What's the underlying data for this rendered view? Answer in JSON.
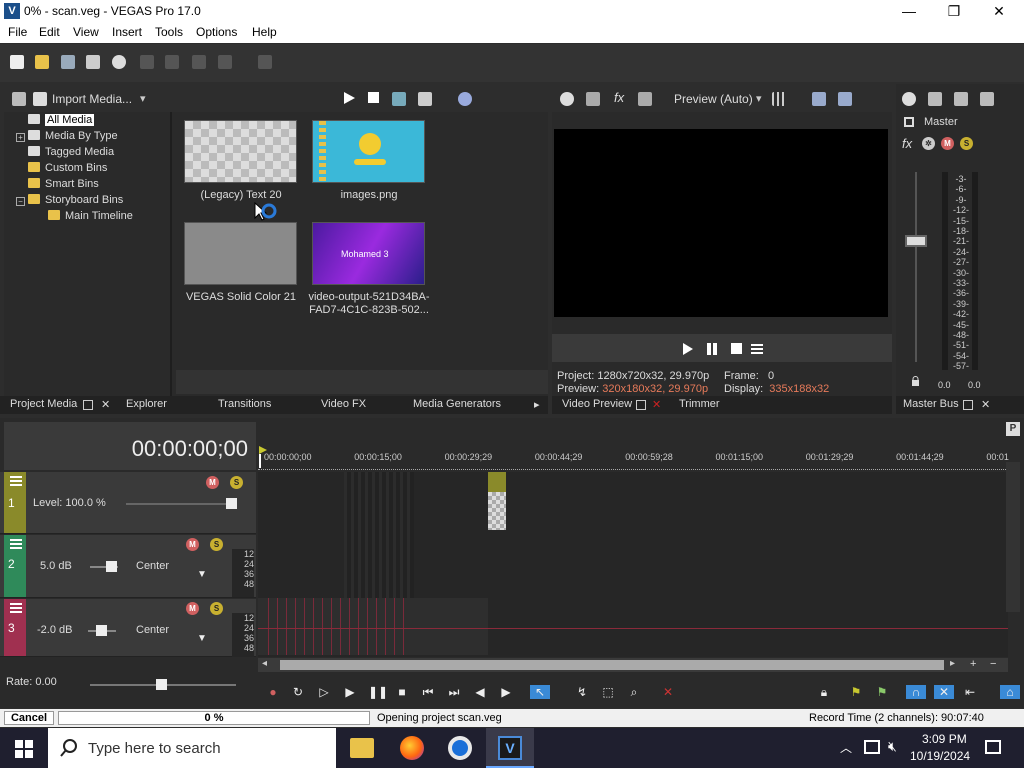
{
  "window": {
    "title": "0% - scan.veg - VEGAS Pro 17.0",
    "logo": "V",
    "minimize": "—",
    "maximize": "❐",
    "close": "✕"
  },
  "menu": [
    "File",
    "Edit",
    "View",
    "Insert",
    "Tools",
    "Options",
    "Help"
  ],
  "media_toolbar": {
    "import_label": "Import Media..."
  },
  "tree": {
    "all_media": "All Media",
    "by_type": "Media By Type",
    "tagged": "Tagged Media",
    "custom": "Custom Bins",
    "smart": "Smart Bins",
    "storyboard": "Storyboard Bins",
    "main_timeline": "Main Timeline",
    "expand": "+",
    "collapse": "−"
  },
  "media_items": [
    {
      "caption": "(Legacy) Text 20"
    },
    {
      "caption": "images.png"
    },
    {
      "caption": "VEGAS Solid Color 21"
    },
    {
      "caption": "video-output-521D34BA-FAD7-4C1C-823B-502...",
      "thumb_text": "Mohamed 3"
    }
  ],
  "left_tabs": {
    "project_media": "Project Media",
    "explorer": "Explorer",
    "transitions": "Transitions",
    "video_fx": "Video FX",
    "media_generators": "Media Generators"
  },
  "preview": {
    "quality": "Preview (Auto)",
    "project_label": "Project:",
    "project_value": "1280x720x32, 29.970p",
    "frame_label": "Frame:",
    "frame_value": "0",
    "preview_label": "Preview:",
    "preview_value": "320x180x32, 29.970p",
    "display_label": "Display:",
    "display_value": "335x188x32"
  },
  "preview_tabs": {
    "video_preview": "Video Preview",
    "trimmer": "Trimmer"
  },
  "master": {
    "label": "Master",
    "fx": "fx",
    "scale": [
      "3",
      "6",
      "9",
      "12",
      "15",
      "18",
      "21",
      "24",
      "27",
      "30",
      "33",
      "36",
      "39",
      "42",
      "45",
      "48",
      "51",
      "54",
      "57"
    ],
    "left_level": "0.0",
    "right_level": "0.0",
    "tab": "Master Bus"
  },
  "timeline": {
    "timecode": "00:00:00;00",
    "ruler": [
      "00:00:00;00",
      "00:00:15;00",
      "00:00:29;29",
      "00:00:44;29",
      "00:00:59;28",
      "00:01:15;00",
      "00:01:29;29",
      "00:01:44;29",
      "00:01"
    ]
  },
  "tracks": [
    {
      "num": "1",
      "level": "Level: 100.0 %",
      "color": "#8a8a2a"
    },
    {
      "num": "2",
      "level": "5.0 dB",
      "pan": "Center",
      "color": "#2f8a5a",
      "meter": [
        "12",
        "24",
        "36",
        "48"
      ]
    },
    {
      "num": "3",
      "level": "-2.0 dB",
      "pan": "Center",
      "color": "#a03050",
      "meter": [
        "12",
        "24",
        "36",
        "48"
      ]
    }
  ],
  "rate": "Rate: 0.00",
  "status": {
    "cancel": "Cancel",
    "progress": "0 %",
    "progress_fraction": 0,
    "message": "Opening project scan.veg",
    "record": "Record Time (2 channels): 90:07:40"
  },
  "taskbar": {
    "search": "Type here to search",
    "time": "3:09 PM",
    "date": "10/19/2024"
  },
  "colors": {
    "accent": "#3a8ad6",
    "panel": "#2a2a2a",
    "flag_red": "#cc2222"
  }
}
